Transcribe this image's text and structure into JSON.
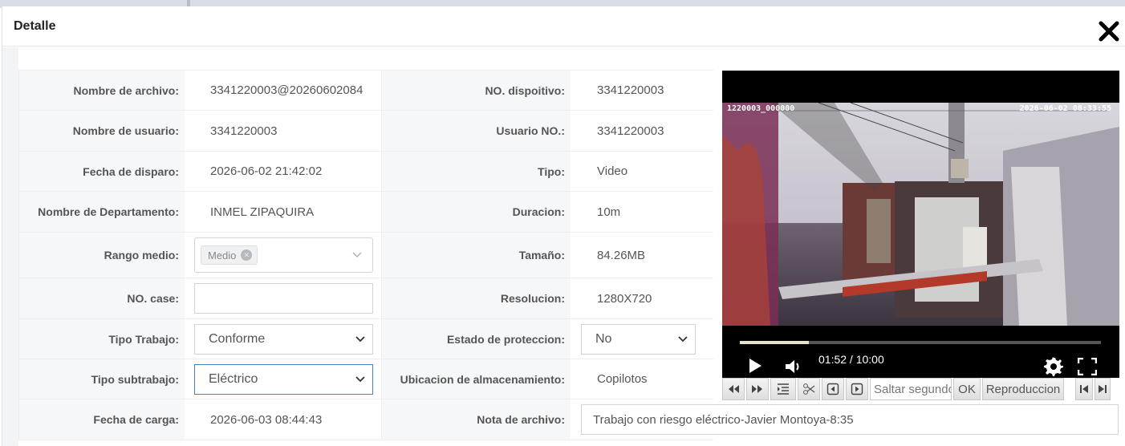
{
  "dialog": {
    "title": "Detalle"
  },
  "fields": {
    "file_name": {
      "label": "Nombre de archivo",
      "value": "3341220003@20260602084"
    },
    "device_no": {
      "label": "NO. dispoitivo",
      "value": "3341220003"
    },
    "user_name": {
      "label": "Nombre de usuario",
      "value": "3341220003"
    },
    "user_no": {
      "label": "Usuario NO.",
      "value": "3341220003"
    },
    "trigger_date": {
      "label": "Fecha de disparo",
      "value": "2026-06-02 21:42:02"
    },
    "type": {
      "label": "Tipo",
      "value": "Video"
    },
    "department": {
      "label": "Nombre de Departamento",
      "value": "INMEL ZIPAQUIRA"
    },
    "duration": {
      "label": "Duracion",
      "value": "10m"
    },
    "medium_range": {
      "label": "Rango medio",
      "chip": "Medio",
      "chip_remove": "×"
    },
    "size": {
      "label": "Tamaño",
      "value": "84.26MB"
    },
    "case_no": {
      "label": "NO. case",
      "value": ""
    },
    "resolution": {
      "label": "Resolucion",
      "value": "1280X720"
    },
    "work_type": {
      "label": "Tipo Trabajo",
      "value": "Conforme"
    },
    "protection": {
      "label": "Estado de proteccion",
      "value": "No"
    },
    "work_subtype": {
      "label": "Tipo subtrabajo",
      "value": "Eléctrico"
    },
    "storage": {
      "label": "Ubicacion de almacenamiento",
      "value": "Copilotos"
    },
    "upload_date": {
      "label": "Fecha de carga",
      "value": "2026-06-03 08:44:43"
    },
    "file_note": {
      "label": "Nota de archivo",
      "value": "Trabajo con riesgo eléctrico-Javier Montoya-8:35"
    }
  },
  "player": {
    "osd_left": "1220003_000000",
    "osd_right": "2026-06-02 08:33:55",
    "time": "01:52 / 10:00",
    "progress": 0.19,
    "buffered": 0.84
  },
  "toolbar": {
    "seek_placeholder": "Saltar segundo",
    "ok_label": "OK",
    "playback_label": "Reproduccion"
  },
  "colors": {
    "progress_fill": "#e8e1c6",
    "active_select_border": "#4a7fb5"
  }
}
